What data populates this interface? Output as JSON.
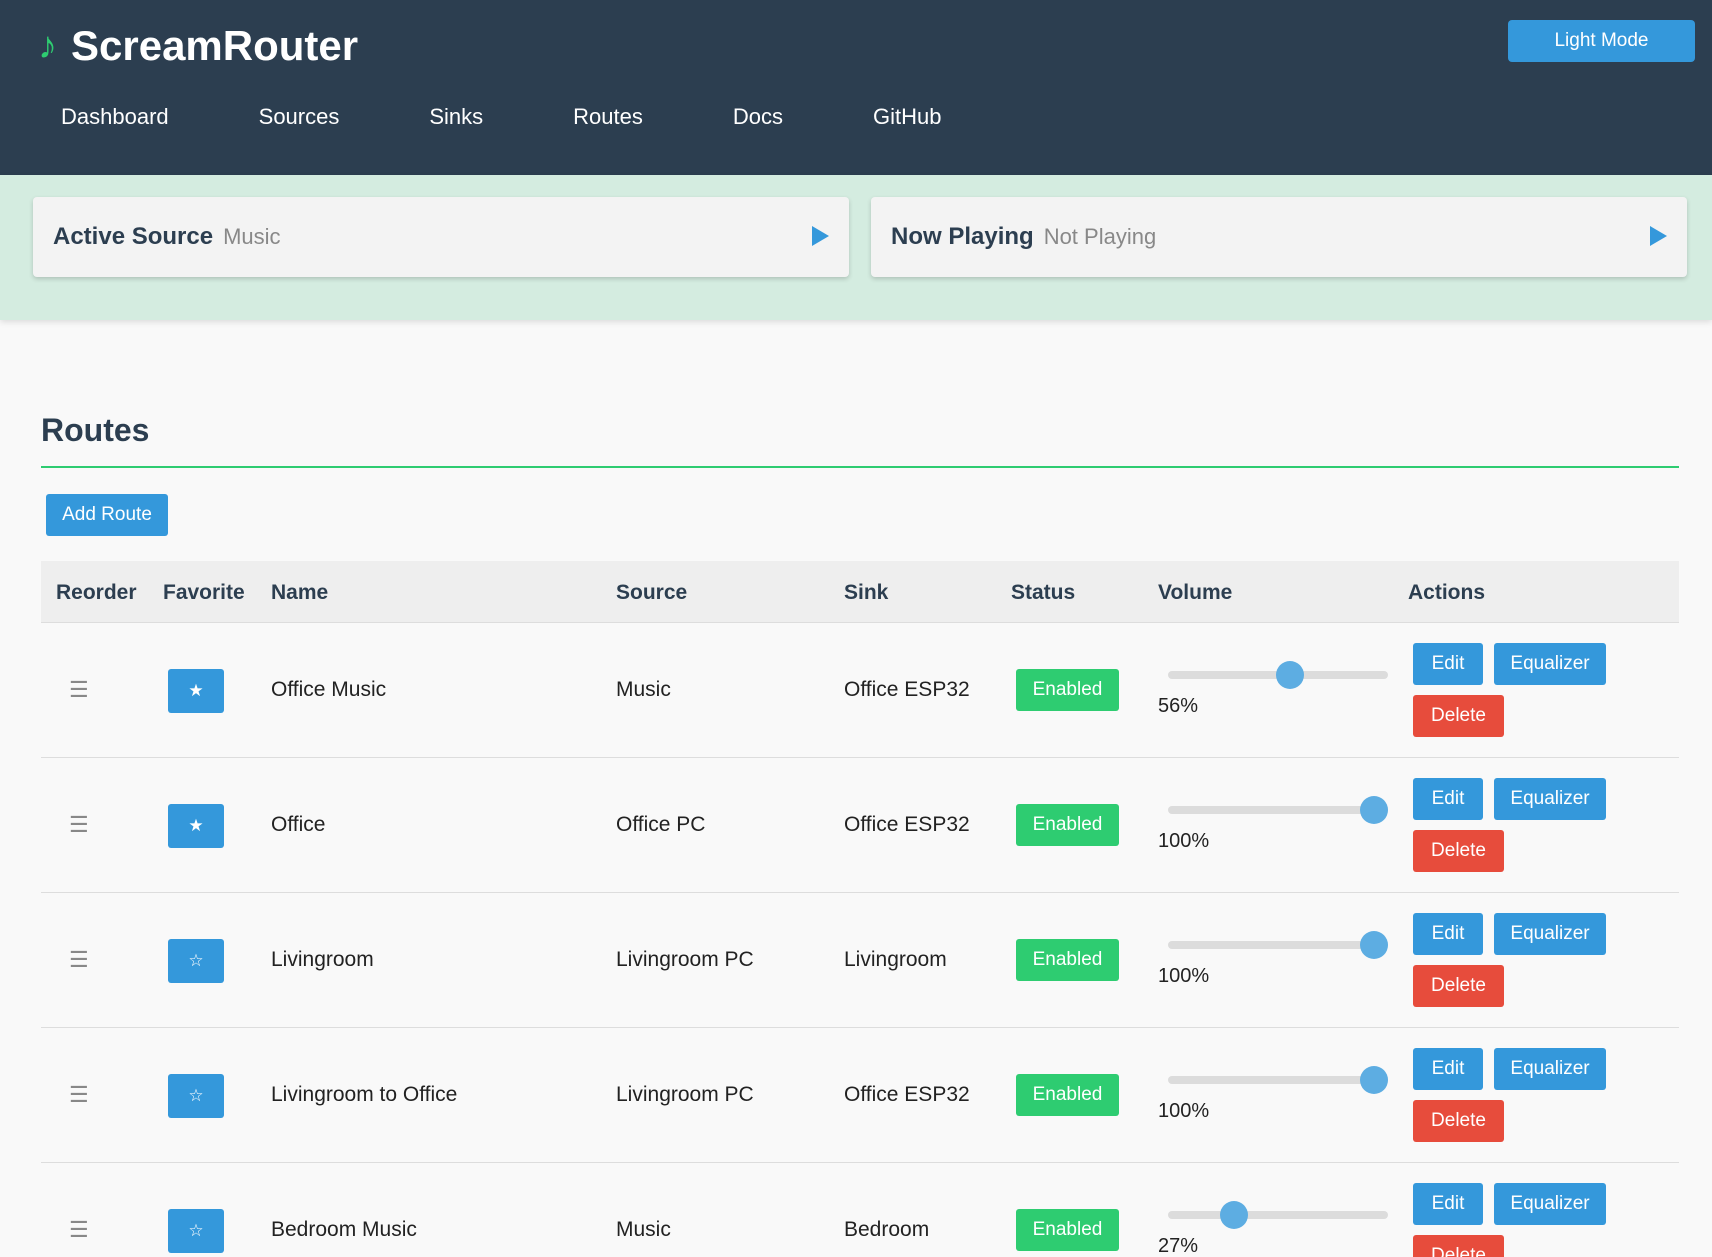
{
  "app": {
    "logo_glyph": "♪",
    "title": "ScreamRouter",
    "mode_button": "Light Mode"
  },
  "nav": [
    "Dashboard",
    "Sources",
    "Sinks",
    "Routes",
    "Docs",
    "GitHub"
  ],
  "now_playing": {
    "active_source_label": "Active Source",
    "active_source_value": "Music",
    "now_playing_label": "Now Playing",
    "now_playing_value": "Not Playing"
  },
  "routes": {
    "title": "Routes",
    "add_button": "Add Route",
    "columns": [
      "Reorder",
      "Favorite",
      "Name",
      "Source",
      "Sink",
      "Status",
      "Volume",
      "Actions"
    ],
    "rows": [
      {
        "drag": "☰",
        "favorite": "★",
        "name": "Office Music",
        "source": "Music",
        "sink": "Office ESP32",
        "status": "Enabled",
        "volume": 56,
        "volume_text": "56%",
        "edit": "Edit",
        "equalizer": "Equalizer",
        "delete": "Delete"
      },
      {
        "drag": "☰",
        "favorite": "★",
        "name": "Office",
        "source": "Office PC",
        "sink": "Office ESP32",
        "status": "Enabled",
        "volume": 100,
        "volume_text": "100%",
        "edit": "Edit",
        "equalizer": "Equalizer",
        "delete": "Delete"
      },
      {
        "drag": "☰",
        "favorite": "☆",
        "name": "Livingroom",
        "source": "Livingroom PC",
        "sink": "Livingroom",
        "status": "Enabled",
        "volume": 100,
        "volume_text": "100%",
        "edit": "Edit",
        "equalizer": "Equalizer",
        "delete": "Delete"
      },
      {
        "drag": "☰",
        "favorite": "☆",
        "name": "Livingroom to Office",
        "source": "Livingroom PC",
        "sink": "Office ESP32",
        "status": "Enabled",
        "volume": 100,
        "volume_text": "100%",
        "edit": "Edit",
        "equalizer": "Equalizer",
        "delete": "Delete"
      },
      {
        "drag": "☰",
        "favorite": "☆",
        "name": "Bedroom Music",
        "source": "Music",
        "sink": "Bedroom",
        "status": "Enabled",
        "volume": 27,
        "volume_text": "27%",
        "edit": "Edit",
        "equalizer": "Equalizer",
        "delete": "Delete"
      }
    ]
  },
  "colors": {
    "header_bg": "#2c3e50",
    "accent": "#3498db",
    "success": "#2ecc71",
    "danger": "#e74c3c",
    "now_playing_bg": "#d4ece0"
  }
}
